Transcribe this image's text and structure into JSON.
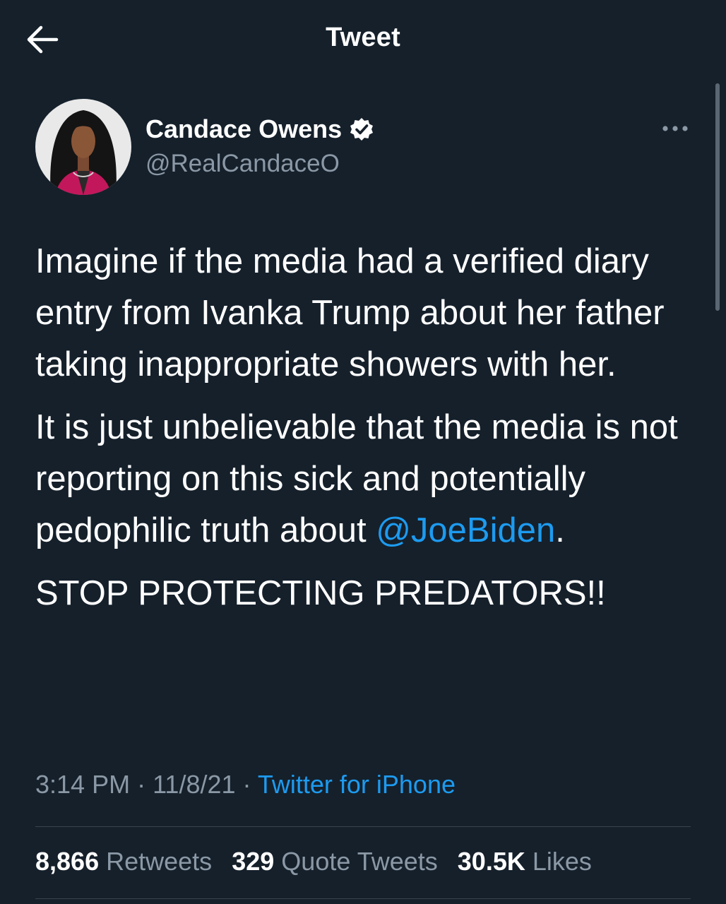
{
  "header": {
    "title": "Tweet",
    "back_icon": "arrow-left-icon"
  },
  "author": {
    "display_name": "Candace Owens",
    "handle": "@RealCandaceO",
    "verified_icon": "verified-badge-icon",
    "more_icon": "more-dots-icon"
  },
  "tweet": {
    "paragraph1": "Imagine if the media had a verified diary entry from Ivanka Trump about her father taking inappropriate showers with her.",
    "paragraph2": "It is just unbelievable that the media is not reporting on this sick and potentially pedophilic truth about",
    "mention": "@JoeBiden",
    "paragraph2_end": ".",
    "paragraph3": "STOP PROTECTING PREDATORS!!"
  },
  "meta": {
    "time": "3:14 PM",
    "sep1": " · ",
    "date": "11/8/21",
    "sep2": " · ",
    "source": "Twitter for iPhone"
  },
  "stats": {
    "retweets_count": "8,866",
    "retweets_label": "Retweets",
    "quotes_count": "329",
    "quotes_label": "Quote Tweets",
    "likes_count": "30.5K",
    "likes_label": "Likes"
  },
  "colors": {
    "background": "#15202b",
    "link": "#1d9bf0",
    "secondary_text": "#8b98a5"
  }
}
